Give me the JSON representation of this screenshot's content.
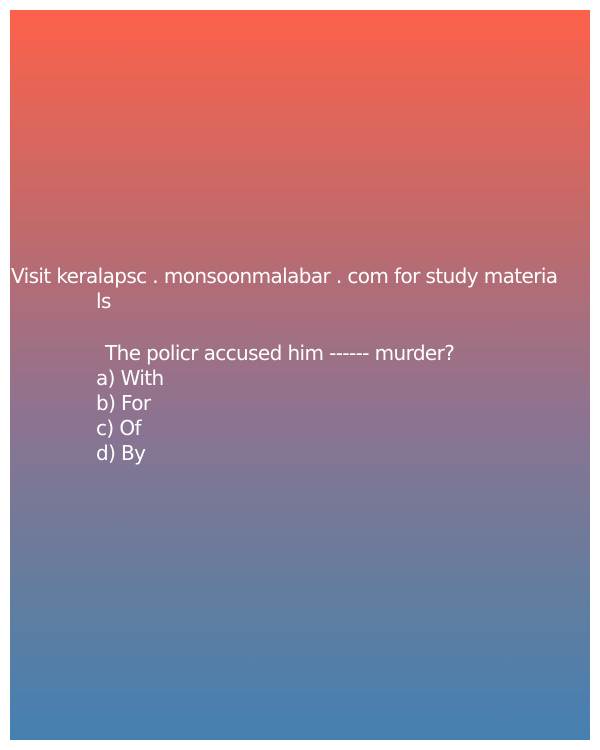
{
  "header": {
    "line1": "Visit keralapsc . monsoonmalabar . com for study materia",
    "line2": "ls"
  },
  "question": {
    "text": "The policr accused him ------ murder?"
  },
  "options": [
    {
      "label": "a) With"
    },
    {
      "label": "b) For"
    },
    {
      "label": "c) Of"
    },
    {
      "label": "d) By"
    }
  ],
  "colors": {
    "gradient_top": "#fd614a",
    "gradient_bottom": "#4580b2",
    "text": "#ffffff"
  }
}
